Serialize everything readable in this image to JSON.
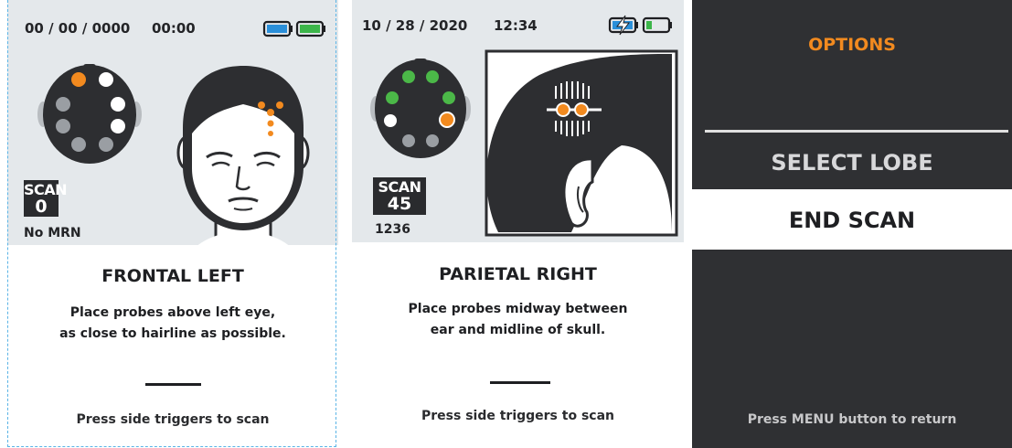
{
  "screens": [
    {
      "date": "00 / 00 / 0000",
      "time": "00:00",
      "scan_label": "SCAN",
      "scan_count": "0",
      "mrn": "No MRN",
      "lobe_title": "FRONTAL LEFT",
      "instruction_line1": "Place probes above left eye,",
      "instruction_line2": "as close to hairline as possible.",
      "hint": "Press side triggers to scan"
    },
    {
      "date": "10 / 28 / 2020",
      "time": "12:34",
      "scan_label": "SCAN",
      "scan_count": "45",
      "mrn": "1236",
      "lobe_title": "PARIETAL RIGHT",
      "instruction_line1": "Place probes midway between",
      "instruction_line2": "ear and midline of skull.",
      "hint": "Press side triggers to scan"
    }
  ],
  "options_menu": {
    "title": "OPTIONS",
    "items": [
      "SELECT LOBE",
      "END SCAN"
    ],
    "selected": "END SCAN",
    "hint": "Press MENU button to return"
  },
  "colors": {
    "accent_orange": "#f28a1f",
    "battery_blue": "#2a8fd9",
    "battery_green": "#3cb54a",
    "dark": "#2f3033"
  }
}
